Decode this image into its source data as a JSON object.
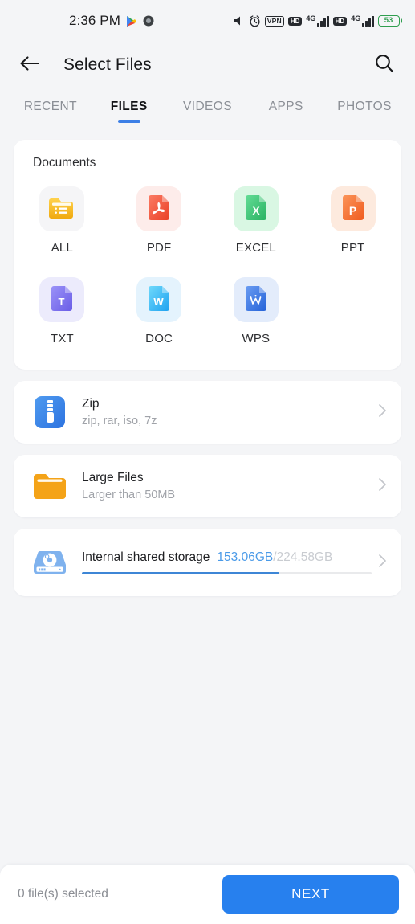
{
  "status_bar": {
    "time": "2:36 PM",
    "left_icons": [
      "play-store-icon",
      "app-badge-icon"
    ],
    "right_icons": [
      "mute-icon",
      "alarm-icon",
      "vpn-icon",
      "hd-icon",
      "signal-4g-icon",
      "hd-icon",
      "signal-4g-icon",
      "battery-icon"
    ],
    "vpn_label": "VPN",
    "hd_label": "HD",
    "network_generation": "4G",
    "battery_percent": "53",
    "battery_color": "#2f9e4f"
  },
  "header": {
    "back_icon": "arrow-left-icon",
    "title": "Select Files",
    "search_icon": "search-icon"
  },
  "tabs": {
    "active_index": 1,
    "accent_color": "#3c7fe6",
    "items": [
      {
        "label": "RECENT"
      },
      {
        "label": "FILES"
      },
      {
        "label": "VIDEOS"
      },
      {
        "label": "APPS"
      },
      {
        "label": "PHOTOS"
      }
    ]
  },
  "documents": {
    "section_title": "Documents",
    "items": [
      {
        "label": "ALL",
        "icon": "folder-list-icon",
        "tile_bg": "#f5f5f7",
        "color_a": "#ffd24d",
        "color_b": "#f2b01e"
      },
      {
        "label": "PDF",
        "icon": "pdf-file-icon",
        "tile_bg": "#fdecea",
        "color_a": "#fa6a5a",
        "color_b": "#ef4733"
      },
      {
        "label": "EXCEL",
        "icon": "excel-file-icon",
        "tile_bg": "#d9f7e3",
        "color_a": "#5fd68d",
        "color_b": "#30b766"
      },
      {
        "label": "PPT",
        "icon": "ppt-file-icon",
        "tile_bg": "#fdeade",
        "color_a": "#fb8a4e",
        "color_b": "#f2652a"
      },
      {
        "label": "TXT",
        "icon": "txt-file-icon",
        "tile_bg": "#ecebfc",
        "color_a": "#8d86f5",
        "color_b": "#6f63e8"
      },
      {
        "label": "DOC",
        "icon": "doc-file-icon",
        "tile_bg": "#e4f3fd",
        "color_a": "#5fd0f8",
        "color_b": "#23a7f2"
      },
      {
        "label": "WPS",
        "icon": "wps-file-icon",
        "tile_bg": "#e3ecfb",
        "color_a": "#5b93ef",
        "color_b": "#2a68dd"
      }
    ]
  },
  "rows": [
    {
      "title": "Zip",
      "subtitle": "zip, rar, iso, 7z",
      "icon": "zip-archive-icon",
      "chevron": "chevron-right-icon"
    },
    {
      "title": "Large Files",
      "subtitle": "Larger than 50MB",
      "icon": "folder-icon",
      "chevron": "chevron-right-icon"
    }
  ],
  "storage": {
    "name": "Internal shared storage",
    "used": "153.06GB",
    "total": "/224.58GB",
    "percent": 68.2,
    "used_color": "#4a9ae8",
    "bar_color": "#3d86d6",
    "icon": "hard-drive-icon",
    "chevron": "chevron-right-icon"
  },
  "bottom_bar": {
    "selected_text": "0 file(s) selected",
    "next_label": "NEXT",
    "next_color": "#2780ee"
  }
}
